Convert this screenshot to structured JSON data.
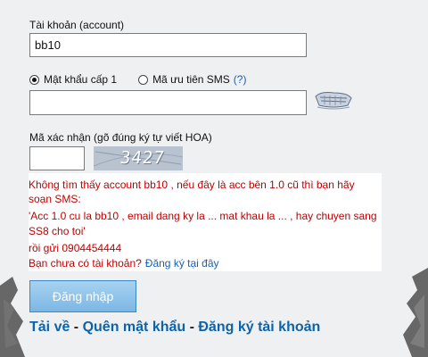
{
  "account": {
    "label": "Tài khoản (account)",
    "value": "bb10"
  },
  "password_mode": {
    "option1_label": "Mật khẩu cấp 1",
    "option2_label": "Mã ưu tiên SMS",
    "help": "(?)",
    "selected": "option1"
  },
  "password": {
    "value": ""
  },
  "keyboard_icon": "virtual-keyboard-icon",
  "captcha": {
    "label": "Mã xác nhận (gõ đúng ký tự viết HOA)",
    "input_value": "",
    "image_text": "3427"
  },
  "message": {
    "line1": "Không tìm thấy account bb10 , nếu đây là acc bên 1.0 cũ thì bạn hãy",
    "line2": "soạn SMS:",
    "line3": "'Acc 1.0 cu la bb10 , email dang ky la ... mat khau la ... , hay chuyen sang",
    "line4": "SS8 cho toi'",
    "line5": "rồi gửi 0904454444",
    "line6_text": "Bạn chưa có tài khoản?",
    "line6_link": "Đăng ký tại đây"
  },
  "login_button": "Đăng nhập",
  "links": {
    "download": "Tải về",
    "sep": " - ",
    "forgot": "Quên mật khẩu",
    "register": "Đăng ký tài khoản"
  },
  "colors": {
    "error_text": "#c00000",
    "link": "#1a5fb4",
    "button": "#7bb7e4"
  }
}
